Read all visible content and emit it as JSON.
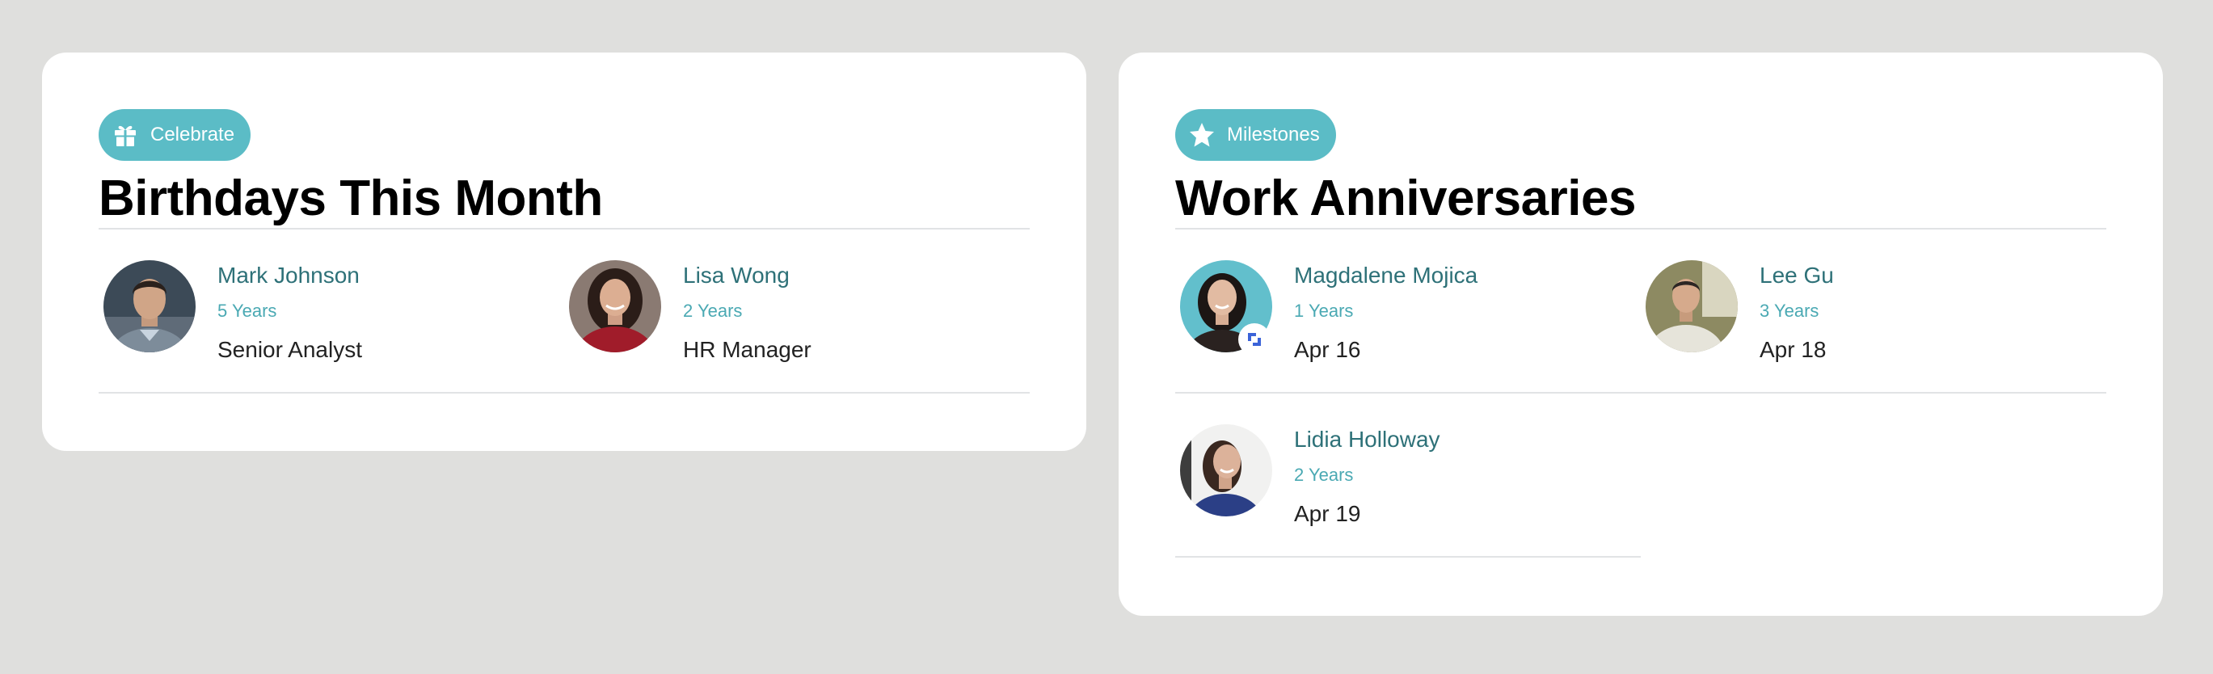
{
  "birthdays": {
    "badge_label": "Celebrate",
    "badge_icon": "gift-icon",
    "title": "Birthdays This Month",
    "people": [
      {
        "name": "Mark Johnson",
        "years": "5 Years",
        "detail": "Senior Analyst"
      },
      {
        "name": "Lisa Wong",
        "years": "2 Years",
        "detail": "HR Manager"
      }
    ]
  },
  "anniversaries": {
    "badge_label": "Milestones",
    "badge_icon": "star-icon",
    "title": "Work Anniversaries",
    "people": [
      {
        "name": "Magdalene Mojica",
        "years": "1 Years",
        "detail": "Apr 16"
      },
      {
        "name": "Lee Gu",
        "years": "3 Years",
        "detail": "Apr 18"
      },
      {
        "name": "Lidia Holloway",
        "years": "2 Years",
        "detail": "Apr 19"
      }
    ]
  },
  "colors": {
    "accent": "#5bbcc6",
    "name_text": "#2e7178",
    "years_text": "#4aa9b3",
    "background": "#dfdfdd"
  }
}
